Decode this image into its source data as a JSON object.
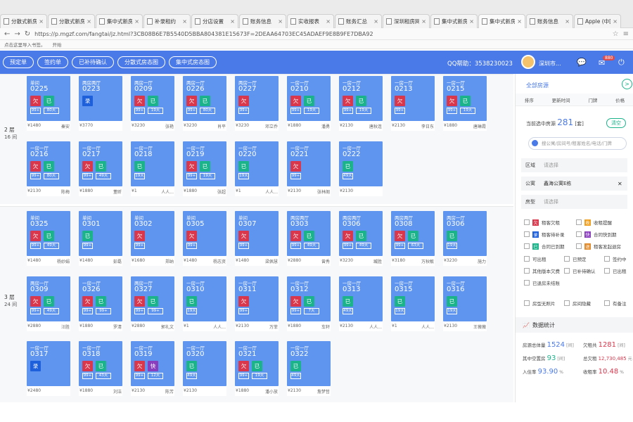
{
  "browser": {
    "tabs": [
      "分散式新房",
      "分散式新房",
      "集中式新房",
      "补录租约",
      "分店设置",
      "账务信息",
      "实收报表",
      "账务汇总",
      "深圳租房网",
      "集中式新房",
      "集中式新房",
      "账务信息",
      "Apple (中国)"
    ],
    "url": "https://p.mgzf.com/fangtai/jz.html?3CB08B6E7B5540D5BBA804381E15673F=2DEAA64703EC45ADAEF9E8B9FE7DBA92",
    "bookmarks": [
      "点击这里导入书签。",
      "开始"
    ]
  },
  "appbar": {
    "buttons": [
      "预定单",
      "签约单",
      "已补待确认",
      "分散式房态图",
      "集中式房态图"
    ],
    "qq": "QQ帮助：3538230023",
    "user": "深圳市...",
    "badge": "880"
  },
  "floors": [
    {
      "label": "2 层",
      "sub": "16 间"
    },
    {
      "label": "3 层",
      "sub": "24 间"
    }
  ],
  "rooms": [
    {
      "type": "单间",
      "no": "0225",
      "chips": [
        [
          "欠",
          "r"
        ],
        [
          "已",
          "g"
        ]
      ],
      "subs": [
        "99+",
        "80天"
      ],
      "price": "¥1480",
      "name": "秦安"
    },
    {
      "type": "两房两厅",
      "no": "0223",
      "chips": [
        [
          "录",
          "b"
        ]
      ],
      "subs": [],
      "price": "¥3770",
      "name": ""
    },
    {
      "type": "两房一厅",
      "no": "0209",
      "chips": [
        [
          "欠",
          "r"
        ],
        [
          "已",
          "g"
        ]
      ],
      "subs": [
        "99+",
        "19天"
      ],
      "price": "¥3230",
      "name": "张艳"
    },
    {
      "type": "两房一厅",
      "no": "0226",
      "chips": [
        [
          "欠",
          "r"
        ],
        [
          "已",
          "g"
        ]
      ],
      "subs": [
        "99+",
        "80天"
      ],
      "price": "¥3230",
      "name": "肖平"
    },
    {
      "type": "两房一厅",
      "no": "0227",
      "chips": [
        [
          "欠",
          "r"
        ]
      ],
      "subs": [
        "99+"
      ],
      "price": "¥3230",
      "name": "邓立乔"
    },
    {
      "type": "一房一厅",
      "no": "0210",
      "chips": [
        [
          "欠",
          "r"
        ],
        [
          "已",
          "g"
        ]
      ],
      "subs": [
        "99+",
        "19天"
      ],
      "price": "¥1880",
      "name": "潘勇"
    },
    {
      "type": "一房一厅",
      "no": "0212",
      "chips": [
        [
          "欠",
          "r"
        ],
        [
          "已",
          "g"
        ]
      ],
      "subs": [
        "99+",
        "19天"
      ],
      "price": "¥2130",
      "name": "唐秋连"
    },
    {
      "type": "一房一厅",
      "no": "0213",
      "chips": [
        [
          "欠",
          "r"
        ]
      ],
      "subs": [
        "99+"
      ],
      "price": "¥2130",
      "name": "李日东"
    },
    {
      "type": "一房一厅",
      "no": "0215",
      "chips": [
        [
          "欠",
          "r"
        ],
        [
          "已",
          "g"
        ]
      ],
      "subs": [
        "99+",
        "19天"
      ],
      "price": "¥1880",
      "name": "唐琳霞"
    },
    {
      "type": "一房一厅",
      "no": "0216",
      "chips": [
        [
          "欠",
          "r"
        ],
        [
          "已",
          "g"
        ]
      ],
      "subs": [
        "99+",
        "80天"
      ],
      "price": "¥2130",
      "name": "陈梅"
    },
    {
      "type": "一房一厅",
      "no": "0217",
      "chips": [
        [
          "欠",
          "r"
        ],
        [
          "已",
          "g"
        ]
      ],
      "subs": [
        "99+",
        "49天"
      ],
      "price": "¥1880",
      "name": "董昕"
    },
    {
      "type": "一房一厅",
      "no": "0218",
      "chips": [
        [
          "已",
          "g"
        ]
      ],
      "subs": [
        "19天"
      ],
      "price": "¥1",
      "name": "人人..."
    },
    {
      "type": "一房一厅",
      "no": "0219",
      "chips": [
        [
          "欠",
          "r"
        ],
        [
          "已",
          "g"
        ]
      ],
      "subs": [
        "99+",
        "19天"
      ],
      "price": "¥1880",
      "name": "张超"
    },
    {
      "type": "一房一厅",
      "no": "0220",
      "chips": [
        [
          "已",
          "g"
        ]
      ],
      "subs": [
        "19天"
      ],
      "price": "¥1",
      "name": "人人..."
    },
    {
      "type": "一房一厅",
      "no": "0221",
      "chips": [
        [
          "欠",
          "r"
        ]
      ],
      "subs": [
        "99+"
      ],
      "price": "¥2130",
      "name": "张林阁"
    },
    {
      "type": "一房一厅",
      "no": "0222",
      "chips": [
        [
          "已",
          "g"
        ]
      ],
      "subs": [
        "49天"
      ],
      "price": "¥2130",
      "name": ""
    },
    {
      "type": "单间",
      "no": "0325",
      "chips": [
        [
          "欠",
          "r"
        ],
        [
          "已",
          "g"
        ]
      ],
      "subs": [
        "99+",
        "49天"
      ],
      "price": "¥1480",
      "name": "杨妙娟"
    },
    {
      "type": "单间",
      "no": "0301",
      "chips": [
        [
          "已",
          "g"
        ]
      ],
      "subs": [
        "99+"
      ],
      "price": "¥1480",
      "name": "彭磊"
    },
    {
      "type": "单间",
      "no": "0302",
      "chips": [
        [
          "欠",
          "r"
        ]
      ],
      "subs": [
        "99+"
      ],
      "price": "¥1680",
      "name": "郑纳"
    },
    {
      "type": "单间",
      "no": "0305",
      "chips": [
        [
          "欠",
          "r"
        ]
      ],
      "subs": [
        "99+"
      ],
      "price": "¥1480",
      "name": "杨志资"
    },
    {
      "type": "单间",
      "no": "0307",
      "chips": [
        [
          "欠",
          "r"
        ]
      ],
      "subs": [
        "99+"
      ],
      "price": "¥1480",
      "name": "梁佩慧"
    },
    {
      "type": "两房两厅",
      "no": "0303",
      "chips": [
        [
          "欠",
          "r"
        ],
        [
          "已",
          "g"
        ]
      ],
      "subs": [
        "99+",
        "49天"
      ],
      "price": "¥2880",
      "name": "曾秀"
    },
    {
      "type": "两房两厅",
      "no": "0306",
      "chips": [
        [
          "欠",
          "r"
        ],
        [
          "已",
          "g"
        ]
      ],
      "subs": [
        "99+",
        "49天"
      ],
      "price": "¥3230",
      "name": "臧胜"
    },
    {
      "type": "两房两厅",
      "no": "0308",
      "chips": [
        [
          "欠",
          "r"
        ],
        [
          "已",
          "g"
        ]
      ],
      "subs": [
        "99+",
        "63天"
      ],
      "price": "¥3180",
      "name": "万秋敏"
    },
    {
      "type": "两房一厅",
      "no": "0306",
      "chips": [
        [
          "已",
          "g"
        ]
      ],
      "subs": [
        "19天"
      ],
      "price": "¥3230",
      "name": "施力"
    },
    {
      "type": "两房一厅",
      "no": "0309",
      "chips": [
        [
          "欠",
          "r"
        ],
        [
          "已",
          "g"
        ]
      ],
      "subs": [
        "99+",
        "49天"
      ],
      "price": "¥2880",
      "name": "汪胜"
    },
    {
      "type": "一房一厅",
      "no": "0326",
      "chips": [
        [
          "欠",
          "r"
        ],
        [
          "已",
          "g"
        ]
      ],
      "subs": [
        "99+",
        "99+"
      ],
      "price": "¥1880",
      "name": "罗清"
    },
    {
      "type": "两房一厅",
      "no": "0327",
      "chips": [
        [
          "欠",
          "r"
        ],
        [
          "已",
          "g"
        ]
      ],
      "subs": [
        "99+",
        "99+"
      ],
      "price": "¥2880",
      "name": "郭礼文"
    },
    {
      "type": "一房一厅",
      "no": "0310",
      "chips": [
        [
          "已",
          "g"
        ]
      ],
      "subs": [
        "19天"
      ],
      "price": "¥1",
      "name": "人人..."
    },
    {
      "type": "一房一厅",
      "no": "0311",
      "chips": [
        [
          "欠",
          "r"
        ]
      ],
      "subs": [
        "99+"
      ],
      "price": "¥2130",
      "name": "万菲"
    },
    {
      "type": "一房一厅",
      "no": "0312",
      "chips": [
        [
          "欠",
          "r"
        ],
        [
          "已",
          "g"
        ]
      ],
      "subs": [
        "99+",
        "7天"
      ],
      "price": "¥1880",
      "name": "车轩"
    },
    {
      "type": "一房一厅",
      "no": "0313",
      "chips": [
        [
          "已",
          "g"
        ]
      ],
      "subs": [
        "49天"
      ],
      "price": "¥2130",
      "name": "人人..."
    },
    {
      "type": "一房一厅",
      "no": "0315",
      "chips": [
        [
          "已",
          "g"
        ]
      ],
      "subs": [
        "19天"
      ],
      "price": "¥1",
      "name": "人人..."
    },
    {
      "type": "一房一厅",
      "no": "0316",
      "chips": [
        [
          "已",
          "g"
        ]
      ],
      "subs": [
        "19天"
      ],
      "price": "¥2130",
      "name": "王薇薇"
    },
    {
      "type": "一房一厅",
      "no": "0317",
      "chips": [
        [
          "录",
          "b"
        ]
      ],
      "subs": [],
      "price": "¥2480",
      "name": ""
    },
    {
      "type": "一房一厅",
      "no": "0318",
      "chips": [
        [
          "欠",
          "r"
        ],
        [
          "已",
          "g"
        ]
      ],
      "subs": [
        "99+",
        "43天"
      ],
      "price": "¥1880",
      "name": "刘洁"
    },
    {
      "type": "一房一厅",
      "no": "0319",
      "chips": [
        [
          "欠",
          "r"
        ],
        [
          "快",
          "p"
        ]
      ],
      "subs": [
        "99+",
        "12天"
      ],
      "price": "¥2130",
      "name": "陈芳"
    },
    {
      "type": "一房一厅",
      "no": "0320",
      "chips": [
        [
          "已",
          "g"
        ]
      ],
      "subs": [
        "49天"
      ],
      "price": "¥2130",
      "name": ""
    },
    {
      "type": "一房一厅",
      "no": "0321",
      "chips": [
        [
          "欠",
          "r"
        ],
        [
          "已",
          "g"
        ]
      ],
      "subs": [
        "99+",
        "19天"
      ],
      "price": "¥1880",
      "name": "潘小放"
    },
    {
      "type": "一房一厅",
      "no": "0322",
      "chips": [
        [
          "已",
          "g"
        ]
      ],
      "subs": [
        "49天"
      ],
      "price": "¥2130",
      "name": "詹梦哲"
    }
  ],
  "sidebar": {
    "all_rooms": "全部房源",
    "sort": [
      "排序",
      "更新时间",
      "门牌",
      "价格"
    ],
    "count_label": "当前选中房源",
    "count": "281",
    "count_unit": "[套]",
    "clear": "清空",
    "search_placeholder": "搜公寓/房间号/租客姓名/电话/门牌",
    "filters": [
      {
        "label": "区域",
        "value": "请选择",
        "dark": false,
        "x": ""
      },
      {
        "label": "公寓",
        "value": "鑫海公寓E栋",
        "dark": true,
        "x": "✕"
      },
      {
        "label": "房型",
        "value": "请选择",
        "dark": false,
        "x": ""
      }
    ],
    "tags": [
      {
        "text": "租客欠租",
        "icon": "欠",
        "color": "#d9374c"
      },
      {
        "text": "收租提醒",
        "icon": "收",
        "color": "#f0a020"
      },
      {
        "text": "租客待补录",
        "icon": "录",
        "color": "#1e5fdb"
      },
      {
        "text": "合同快到期",
        "icon": "快",
        "color": "#8a3ebd"
      },
      {
        "text": "合同已到期",
        "icon": "已",
        "color": "#1bb38a"
      },
      {
        "text": "租客发起退房",
        "icon": "退",
        "color": "#e08a2a"
      }
    ],
    "states": [
      "可出租",
      "已预定",
      "签约中",
      "其他版本欠费",
      "已补待确认",
      "已出租",
      "已退房未结账"
    ],
    "misc": [
      "房型无照片",
      "房间隐藏",
      "有备注"
    ],
    "stats_title": "数据统计",
    "stats": [
      {
        "label": "房源总体量",
        "value": "1524",
        "unit": "[间]",
        "cls": "b"
      },
      {
        "label": "欠租共",
        "value": "1281",
        "unit": "[间]",
        "cls": "r"
      },
      {
        "label": "其中空置房",
        "value": "93",
        "unit": "[间]",
        "cls": "g"
      },
      {
        "label": "总欠租",
        "value": "12,730,485",
        "unit": "元",
        "cls": "s"
      },
      {
        "label": "入住率",
        "value": "93.90",
        "unit": "%",
        "cls": "b"
      },
      {
        "label": "收租率",
        "value": "10.48",
        "unit": "%",
        "cls": "r"
      }
    ]
  }
}
